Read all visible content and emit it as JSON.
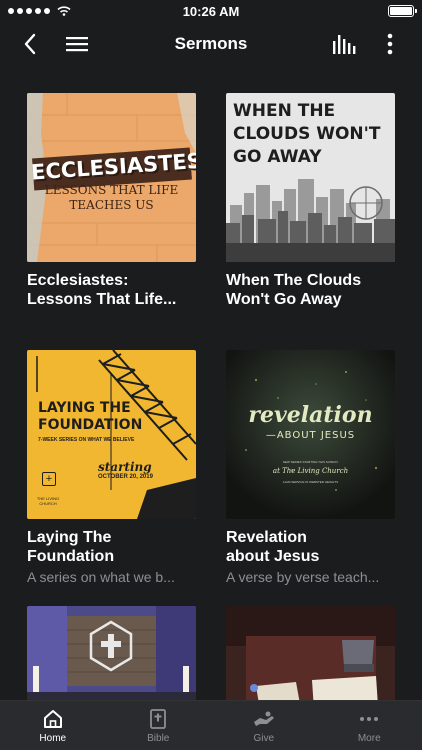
{
  "status_bar": {
    "time": "10:26 AM"
  },
  "header": {
    "title": "Sermons"
  },
  "sermons": [
    {
      "title_line1": "Ecclesiastes:",
      "title_line2": "Lessons That Life...",
      "subtitle": "",
      "art": {
        "title": "ECCLESIASTES",
        "subtitle_line1": "LESSONS THAT LIFE",
        "subtitle_line2": "TEACHES US"
      }
    },
    {
      "title_line1": "When The Clouds",
      "title_line2": "Won't Go Away",
      "subtitle": "",
      "art": {
        "line1": "WHEN THE",
        "line2": "CLOUDS WON'T",
        "line3": "GO AWAY"
      }
    },
    {
      "title_line1": "Laying The",
      "title_line2": "Foundation",
      "subtitle": "A series on what we b...",
      "art": {
        "line1": "LAYING THE",
        "line2": "FOUNDATION",
        "tagline": "7-WEEK SERIES ON WHAT WE BELIEVE",
        "starting": "starting",
        "date": "OCTOBER 20, 2019",
        "church": "THE LIVING CHURCH"
      }
    },
    {
      "title_line1": "Revelation",
      "title_line2": "about Jesus",
      "subtitle": "A verse by verse teach...",
      "art": {
        "line1": "revelation",
        "line2": "—ABOUT JESUS",
        "small1": "NEW SERIES STARTING THIS SUNDAY",
        "script": "at The Living Church",
        "small2": "11AM SERVICE IN WEBSTER HEIGHTS"
      }
    },
    {
      "title_line1": "",
      "title_line2": "",
      "subtitle": ""
    },
    {
      "title_line1": "",
      "title_line2": "",
      "subtitle": ""
    }
  ],
  "tabs": [
    {
      "label": "Home",
      "icon": "home-icon",
      "active": true
    },
    {
      "label": "Bible",
      "icon": "bible-icon",
      "active": false
    },
    {
      "label": "Give",
      "icon": "give-icon",
      "active": false
    },
    {
      "label": "More",
      "icon": "more-icon",
      "active": false
    }
  ],
  "colors": {
    "background": "#1b1c1e",
    "tabbar": "#2a2b2e",
    "muted_text": "#8d8f93",
    "foundation_yellow": "#f2b731"
  }
}
